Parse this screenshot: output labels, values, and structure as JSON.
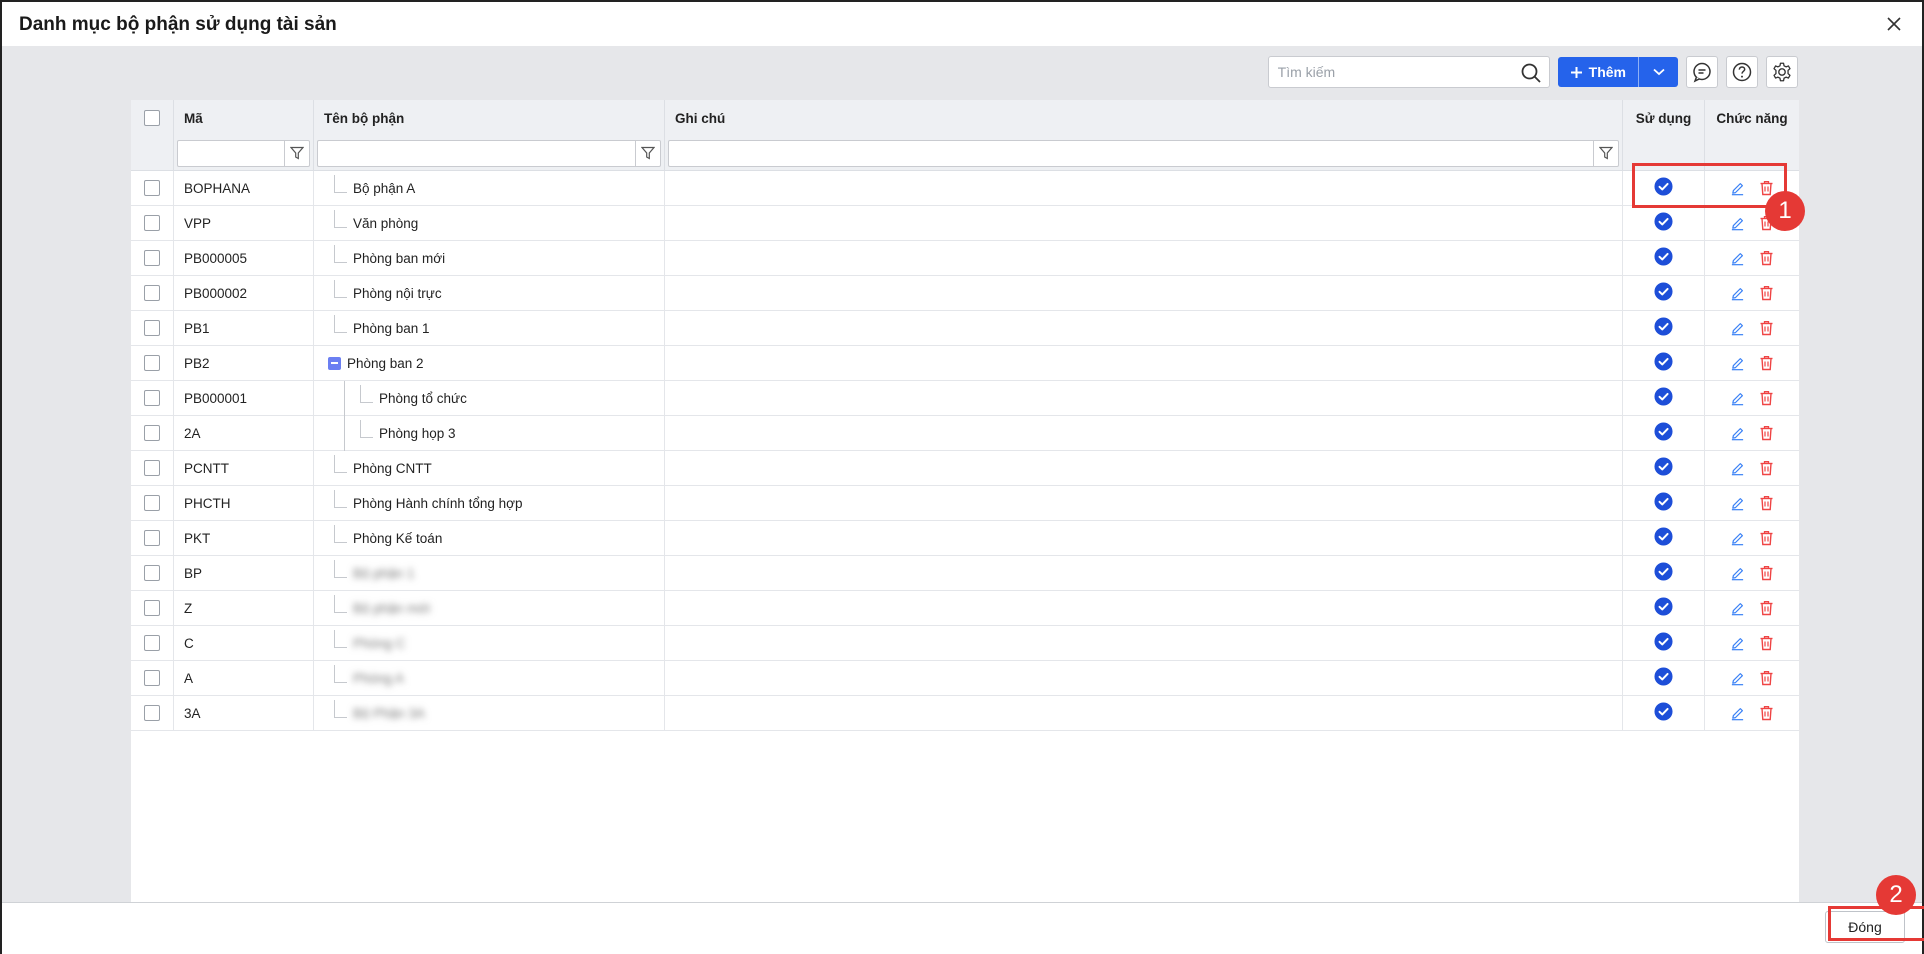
{
  "dialog": {
    "title": "Danh mục bộ phận sử dụng tài sản"
  },
  "toolbar": {
    "search_placeholder": "Tìm kiếm",
    "add_label": "Thêm"
  },
  "grid": {
    "columns": {
      "code": "Mã",
      "name": "Tên bộ phận",
      "note": "Ghi chú",
      "in_use": "Sử dụng",
      "actions": "Chức năng"
    },
    "rows": [
      {
        "code": "BOPHANA",
        "name": "Bộ phận A",
        "level": 1,
        "in_use": true
      },
      {
        "code": "VPP",
        "name": "Văn phòng",
        "level": 1,
        "in_use": true
      },
      {
        "code": "PB000005",
        "name": "Phòng ban mới",
        "level": 1,
        "in_use": true
      },
      {
        "code": "PB000002",
        "name": "Phòng nội trực",
        "level": 1,
        "in_use": true
      },
      {
        "code": "PB1",
        "name": "Phòng ban 1",
        "level": 1,
        "in_use": true
      },
      {
        "code": "PB2",
        "name": "Phòng ban 2",
        "level": 1,
        "expanded": true,
        "in_use": true
      },
      {
        "code": "PB000001",
        "name": "Phòng tổ chức",
        "level": 2,
        "in_use": true
      },
      {
        "code": "2A",
        "name": "Phòng họp 3",
        "level": 2,
        "in_use": true
      },
      {
        "code": "PCNTT",
        "name": "Phòng CNTT",
        "level": 1,
        "in_use": true
      },
      {
        "code": "PHCTH",
        "name": "Phòng Hành chính tổng hợp",
        "level": 1,
        "in_use": true
      },
      {
        "code": "PKT",
        "name": "Phòng Kế toán",
        "level": 1,
        "in_use": true
      },
      {
        "code": "BP",
        "name": "Bộ phận 1",
        "level": 1,
        "blurred": true,
        "in_use": true
      },
      {
        "code": "Z",
        "name": "Bộ phận mới",
        "level": 1,
        "blurred": true,
        "in_use": true
      },
      {
        "code": "C",
        "name": "Phòng C",
        "level": 1,
        "blurred": true,
        "in_use": true
      },
      {
        "code": "A",
        "name": "Phòng A",
        "level": 1,
        "blurred": true,
        "in_use": true
      },
      {
        "code": "3A",
        "name": "Bộ Phận 3A",
        "level": 1,
        "blurred": true,
        "in_use": true
      }
    ]
  },
  "footer": {
    "close_label": "Đóng"
  },
  "annotations": {
    "badge1": "1",
    "badge2": "2"
  },
  "colors": {
    "primary": "#2563eb",
    "check": "#1d4ed8",
    "edit": "#3b82f6",
    "delete": "#ef4444",
    "highlight": "#e53935"
  }
}
